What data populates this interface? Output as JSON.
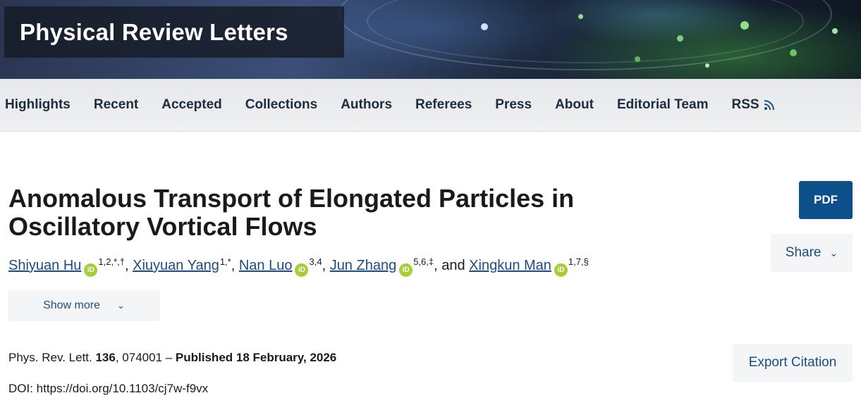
{
  "journal": {
    "title": "Physical Review Letters"
  },
  "nav": {
    "items": [
      {
        "label": "Highlights"
      },
      {
        "label": "Recent"
      },
      {
        "label": "Accepted"
      },
      {
        "label": "Collections"
      },
      {
        "label": "Authors"
      },
      {
        "label": "Referees"
      },
      {
        "label": "Press"
      },
      {
        "label": "About"
      },
      {
        "label": "Editorial Team"
      },
      {
        "label": "RSS",
        "icon": "rss-icon"
      }
    ]
  },
  "article": {
    "title": "Anomalous Transport of Elongated Particles in Oscillatory Vortical Flows",
    "authors": [
      {
        "name": "Shiyuan Hu",
        "orcid": true,
        "affiliations": "1,2,*,†",
        "separator": ", "
      },
      {
        "name": "Xiuyuan Yang",
        "orcid": false,
        "affiliations": "1,*",
        "separator": ", "
      },
      {
        "name": "Nan Luo",
        "orcid": true,
        "affiliations": "3,4",
        "separator": ", "
      },
      {
        "name": "Jun Zhang",
        "orcid": true,
        "affiliations": "5,6,‡",
        "separator": ", and "
      },
      {
        "name": "Xingkun Man",
        "orcid": true,
        "affiliations": "1,7,§",
        "separator": ""
      }
    ],
    "orcid_icon_text": "iD",
    "show_more_label": "Show more",
    "citation": {
      "journal_abbrev": "Phys. Rev. Lett. ",
      "volume": "136",
      "article_number": ", 074001 – ",
      "published": "Published 18 February, 2026"
    },
    "doi": "DOI: https://doi.org/10.1103/cj7w-f9vx"
  },
  "actions": {
    "pdf_label": "PDF",
    "share_label": "Share",
    "export_label": "Export Citation"
  },
  "colors": {
    "brand_blue": "#0d4f8b",
    "link_blue": "#1d4d80",
    "orcid_green": "#a6ce39"
  }
}
